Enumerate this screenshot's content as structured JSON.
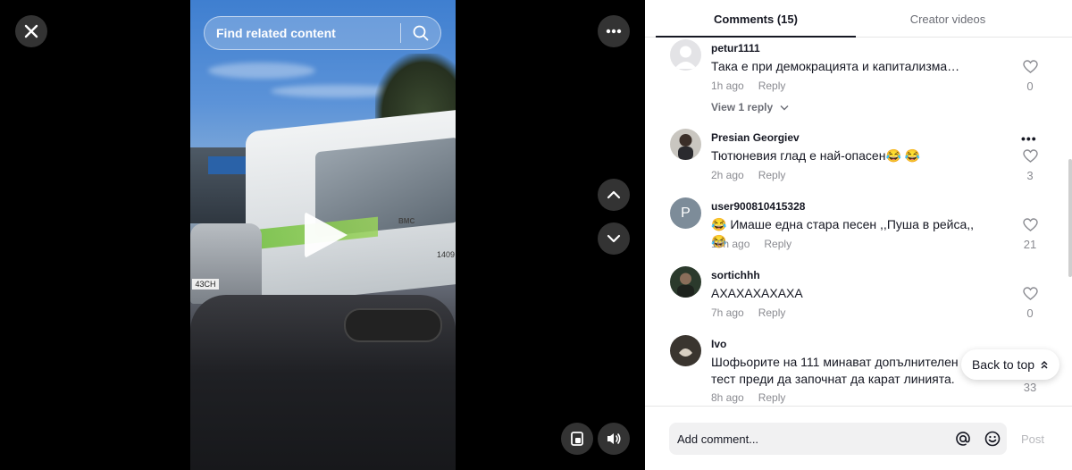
{
  "search": {
    "placeholder": "Find related content"
  },
  "tabs": [
    {
      "label": "Comments (15)",
      "active": true
    },
    {
      "label": "Creator videos",
      "active": false
    }
  ],
  "video_overlay": {
    "bus_plate": "BMC",
    "bus_number": "1409",
    "car_plate": "43CH"
  },
  "comments": [
    {
      "user": "petur1111",
      "text": "Така е при демокрацията и капитализма…",
      "time": "1h ago",
      "reply": "Reply",
      "likes": "0",
      "avatar": "default-avatar",
      "view_replies": "View 1 reply"
    },
    {
      "user": "Presian Georgiev",
      "text": "Тютюневия глад е най-опасен😂 😂",
      "time": "2h ago",
      "reply": "Reply",
      "likes": "3",
      "avatar": "photo-avatar",
      "more": "•••"
    },
    {
      "user": "user900810415328",
      "text": "😂 Имаше една стара песен ,,Пуша в рейса,, 😂",
      "time": "10h ago",
      "reply": "Reply",
      "likes": "21",
      "avatar": "letter-avatar",
      "avatar_letter": "P"
    },
    {
      "user": "sortichhh",
      "text": "АХАХАХАХАХА",
      "time": "7h ago",
      "reply": "Reply",
      "likes": "0",
      "avatar": "photo-avatar"
    },
    {
      "user": "Ivo",
      "text": "Шофьорите на 111 минават допълнителен п тест преди да започнат да карат линията.",
      "time": "8h ago",
      "reply": "Reply",
      "likes": "33",
      "avatar": "photo-avatar"
    }
  ],
  "back_to_top": {
    "label": "Back to top"
  },
  "composer": {
    "placeholder": "Add comment...",
    "post_label": "Post"
  },
  "colors": {
    "text": "#161823",
    "muted": "#8a8b91",
    "divider": "#e6e6e6"
  }
}
